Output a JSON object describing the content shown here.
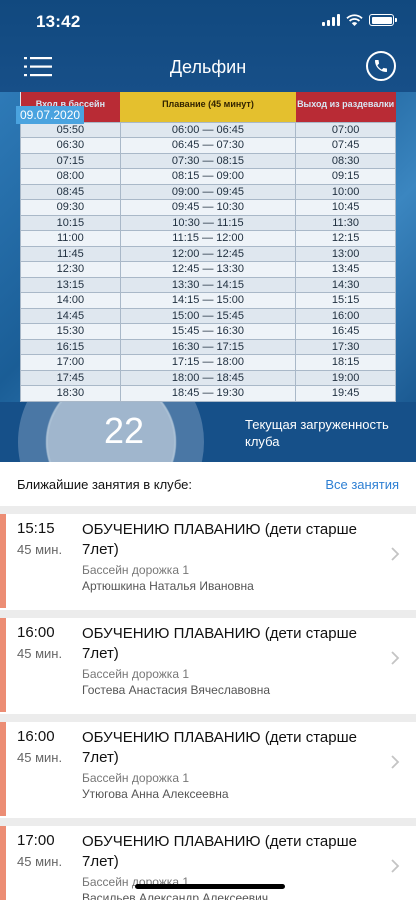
{
  "status_bar": {
    "time": "13:42"
  },
  "header": {
    "title": "Дельфин"
  },
  "banner": {
    "date": "09.07.2020",
    "columns": [
      "Вход в бассейн",
      "Плавание (45 минут)",
      "Выход из раздевалки"
    ],
    "rows": [
      [
        "05:50",
        "06:00 — 06:45",
        "07:00"
      ],
      [
        "06:30",
        "06:45 — 07:30",
        "07:45"
      ],
      [
        "07:15",
        "07:30 — 08:15",
        "08:30"
      ],
      [
        "08:00",
        "08:15 — 09:00",
        "09:15"
      ],
      [
        "08:45",
        "09:00 — 09:45",
        "10:00"
      ],
      [
        "09:30",
        "09:45 — 10:30",
        "10:45"
      ],
      [
        "10:15",
        "10:30 — 11:15",
        "11:30"
      ],
      [
        "11:00",
        "11:15 — 12:00",
        "12:15"
      ],
      [
        "11:45",
        "12:00 — 12:45",
        "13:00"
      ],
      [
        "12:30",
        "12:45 — 13:30",
        "13:45"
      ],
      [
        "13:15",
        "13:30 — 14:15",
        "14:30"
      ],
      [
        "14:00",
        "14:15 — 15:00",
        "15:15"
      ],
      [
        "14:45",
        "15:00 — 15:45",
        "16:00"
      ],
      [
        "15:30",
        "15:45 — 16:30",
        "16:45"
      ],
      [
        "16:15",
        "16:30 — 17:15",
        "17:30"
      ],
      [
        "17:00",
        "17:15 — 18:00",
        "18:15"
      ],
      [
        "17:45",
        "18:00 — 18:45",
        "19:00"
      ],
      [
        "18:30",
        "18:45 — 19:30",
        "19:45"
      ]
    ]
  },
  "load": {
    "value": "22",
    "label": "Текущая загруженность клуба"
  },
  "classes_section": {
    "title": "Ближайшие занятия в клубе:",
    "all_link": "Все занятия"
  },
  "classes": [
    {
      "time": "15:15",
      "duration": "45 мин.",
      "title": "ОБУЧЕНИЮ ПЛАВАНИЮ (дети старше 7лет)",
      "place": "Бассейн дорожка 1",
      "trainer": "Артюшкина Наталья Ивановна"
    },
    {
      "time": "16:00",
      "duration": "45 мин.",
      "title": "ОБУЧЕНИЮ ПЛАВАНИЮ (дети старше 7лет)",
      "place": "Бассейн дорожка 1",
      "trainer": "Гостева Анастасия Вячеславовна"
    },
    {
      "time": "16:00",
      "duration": "45 мин.",
      "title": "ОБУЧЕНИЮ ПЛАВАНИЮ (дети старше 7лет)",
      "place": "Бассейн дорожка 1",
      "trainer": "Утюгова Анна Алексеевна"
    },
    {
      "time": "17:00",
      "duration": "45 мин.",
      "title": "ОБУЧЕНИЮ ПЛАВАНИЮ (дети старше 7лет)",
      "place": "Бассейн дорожка 1",
      "trainer": "Васильев Александр Алексеевич"
    }
  ],
  "colors": {
    "header": "#11497f",
    "accent": "#ec8d74",
    "link": "#2d7fd3"
  }
}
